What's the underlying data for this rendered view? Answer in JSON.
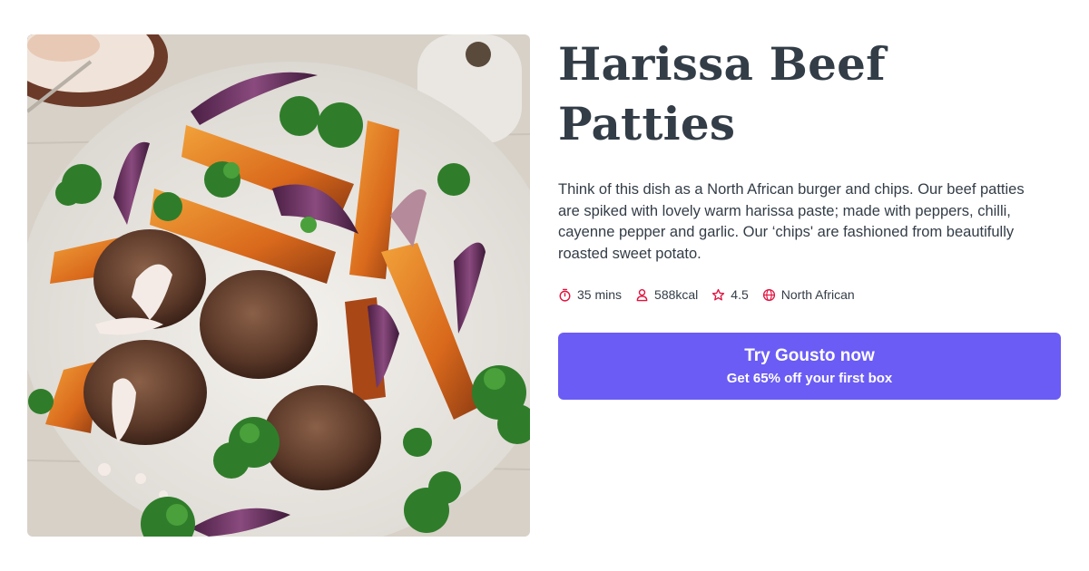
{
  "recipe": {
    "title": "Harissa Beef Patties",
    "description": "Think of this dish as a North African burger and chips. Our beef patties are spiked with lovely warm harissa paste; made with peppers, chilli, cayenne pepper and garlic. Our ‘chips' are fashioned from beautifully roasted sweet potato.",
    "meta": {
      "time": {
        "icon": "stopwatch-icon",
        "label": "35 mins"
      },
      "calories": {
        "icon": "person-icon",
        "label": "588kcal"
      },
      "rating": {
        "icon": "star-icon",
        "label": "4.5"
      },
      "cuisine": {
        "icon": "globe-icon",
        "label": "North African"
      }
    }
  },
  "cta": {
    "title": "Try Gousto now",
    "subtitle": "Get 65% off your first box"
  },
  "colors": {
    "title_text": "#333d47",
    "body_text": "#333d47",
    "icon_accent": "#e0123f",
    "cta_background": "#6b5cf5",
    "cta_text": "#ffffff"
  }
}
